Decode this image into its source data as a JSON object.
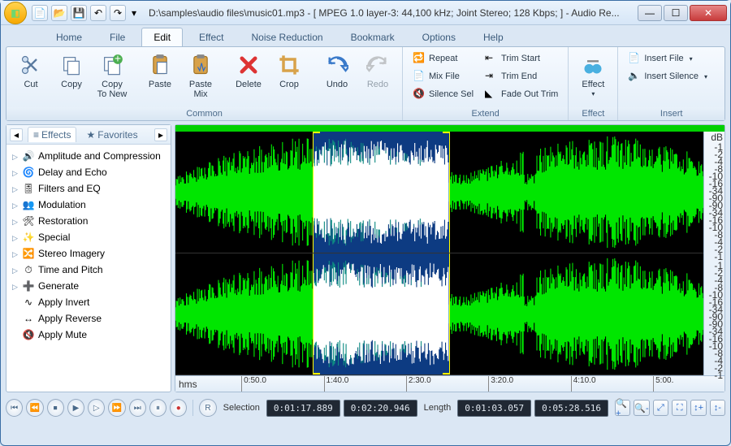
{
  "title": "D:\\samples\\audio files\\music01.mp3 - [ MPEG 1.0 layer-3: 44,100 kHz; Joint Stereo; 128 Kbps;  ] - Audio Re...",
  "tabs": [
    "Home",
    "File",
    "Edit",
    "Effect",
    "Noise Reduction",
    "Bookmark",
    "Options",
    "Help"
  ],
  "active_tab": "Edit",
  "ribbon": {
    "common": {
      "label": "Common",
      "cut": "Cut",
      "copy": "Copy",
      "copy_new": "Copy\nTo New",
      "paste": "Paste",
      "paste_mix": "Paste\nMix",
      "delete": "Delete",
      "crop": "Crop",
      "undo": "Undo",
      "redo": "Redo"
    },
    "extend": {
      "label": "Extend",
      "repeat": "Repeat",
      "mixfile": "Mix File",
      "silence_sel": "Silence Sel",
      "trim_start": "Trim Start",
      "trim_end": "Trim End",
      "fade_out_trim": "Fade Out Trim"
    },
    "effect": {
      "label": "Effect",
      "btn": "Effect"
    },
    "insert": {
      "label": "Insert",
      "insert_file": "Insert File",
      "insert_silence": "Insert Silence"
    }
  },
  "side": {
    "tab_effects": "Effects",
    "tab_favorites": "Favorites",
    "items": [
      "Amplitude and Compression",
      "Delay and Echo",
      "Filters and EQ",
      "Modulation",
      "Restoration",
      "Special",
      "Stereo Imagery",
      "Time and Pitch",
      "Generate",
      "Apply Invert",
      "Apply Reverse",
      "Apply Mute"
    ]
  },
  "db": {
    "unit": "dB",
    "marks": [
      "-1",
      "-2",
      "-4",
      "-8",
      "-10",
      "-16",
      "-34",
      "-90",
      "-90",
      "-34",
      "-16",
      "-10",
      "-8",
      "-4",
      "-2",
      "-1"
    ]
  },
  "ruler": {
    "unit": "hms",
    "ticks": [
      "0:50.0",
      "1:40.0",
      "2:30.0",
      "3:20.0",
      "4:10.0",
      "5:00."
    ]
  },
  "status": {
    "selection_label": "Selection",
    "length_label": "Length",
    "sel_from": "0:01:17.889",
    "sel_to": "0:02:20.946",
    "len_sel": "0:01:03.057",
    "len_tot": "0:05:28.516",
    "loop": "R"
  }
}
